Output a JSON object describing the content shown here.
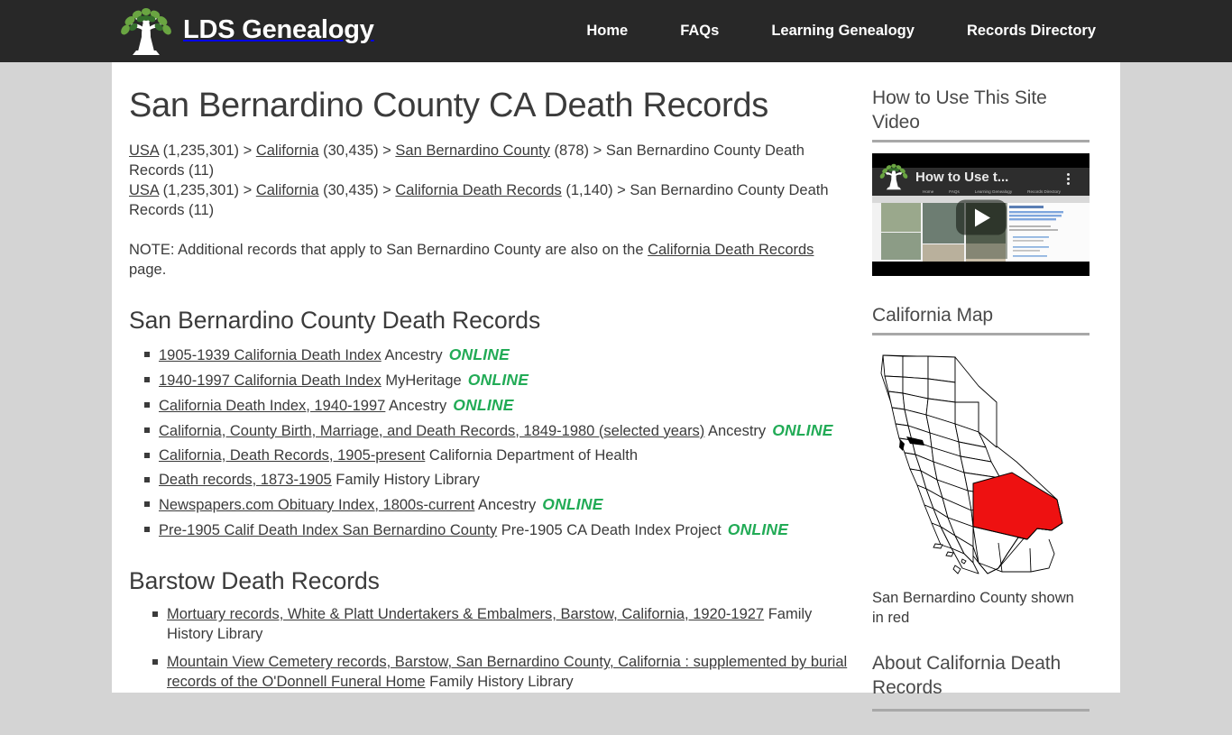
{
  "header": {
    "brand": "LDS Genealogy",
    "logo_icon": "tree-logo-icon",
    "nav": [
      {
        "label": "Home"
      },
      {
        "label": "FAQs"
      },
      {
        "label": "Learning Genealogy"
      },
      {
        "label": "Records Directory"
      }
    ]
  },
  "main": {
    "title": "San Bernardino County CA Death Records",
    "breadcrumbs": [
      [
        {
          "text": "USA",
          "link": true
        },
        {
          "text": " (1,235,301) > ",
          "link": false
        },
        {
          "text": "California",
          "link": true
        },
        {
          "text": " (30,435) > ",
          "link": false
        },
        {
          "text": "San Bernardino County",
          "link": true
        },
        {
          "text": " (878) > San Bernardino County Death Records (11)",
          "link": false
        }
      ],
      [
        {
          "text": "USA",
          "link": true
        },
        {
          "text": " (1,235,301) > ",
          "link": false
        },
        {
          "text": "California",
          "link": true
        },
        {
          "text": " (30,435) > ",
          "link": false
        },
        {
          "text": "California Death Records",
          "link": true
        },
        {
          "text": " (1,140) > San Bernardino County Death Records (11)",
          "link": false
        }
      ]
    ],
    "note": {
      "before": "NOTE: Additional records that apply to San Bernardino County are also on the ",
      "link": "California Death Records",
      "after": " page."
    },
    "sections": [
      {
        "heading": "San Bernardino County Death Records",
        "items": [
          {
            "title": "1905-1939 California Death Index",
            "source": "Ancestry",
            "online": "ONLINE"
          },
          {
            "title": "1940-1997 California Death Index",
            "source": "MyHeritage",
            "online": "ONLINE"
          },
          {
            "title": "California Death Index, 1940-1997",
            "source": "Ancestry",
            "online": "ONLINE"
          },
          {
            "title": "California, County Birth, Marriage, and Death Records, 1849-1980 (selected years)",
            "source": "Ancestry",
            "online": "ONLINE"
          },
          {
            "title": "California, Death Records, 1905-present",
            "source": "California Department of Health",
            "online": ""
          },
          {
            "title": "Death records, 1873-1905",
            "source": "Family History Library",
            "online": ""
          },
          {
            "title": "Newspapers.com Obituary Index, 1800s-current",
            "source": "Ancestry",
            "online": "ONLINE"
          },
          {
            "title": "Pre-1905 Calif Death Index San Bernardino County",
            "source": "Pre-1905 CA Death Index Project",
            "online": "ONLINE"
          }
        ]
      },
      {
        "heading": "Barstow Death Records",
        "items": [
          {
            "title": "Mortuary records, White & Platt Undertakers & Embalmers, Barstow, California, 1920-1927",
            "source": "Family History Library",
            "online": ""
          },
          {
            "title": "Mountain View Cemetery records, Barstow, San Bernardino County, California : supplemented by burial records of the O'Donnell Funeral Home",
            "source": "Family History Library",
            "online": ""
          }
        ]
      }
    ]
  },
  "sidebar": {
    "video": {
      "heading": "How to Use This Site Video",
      "overlay_title": "How to Use t...",
      "play_icon": "play-button-icon",
      "menu_icon": "kebab-menu-icon",
      "logo_icon": "tree-logo-icon",
      "mini_nav": [
        "Home",
        "FAQs",
        "Learning Genealogy",
        "Records Directory"
      ]
    },
    "map": {
      "heading": "California Map",
      "caption": "San Bernardino County shown in red",
      "highlight_color": "#ee1111"
    },
    "about": {
      "heading": "About California Death Records"
    }
  },
  "colors": {
    "header_bg": "#282828",
    "page_bg": "#d4d4d4",
    "content_bg": "#ffffff",
    "text": "#3b3b3b",
    "online_green": "#22ab56",
    "rule": "#a8a8a8"
  }
}
